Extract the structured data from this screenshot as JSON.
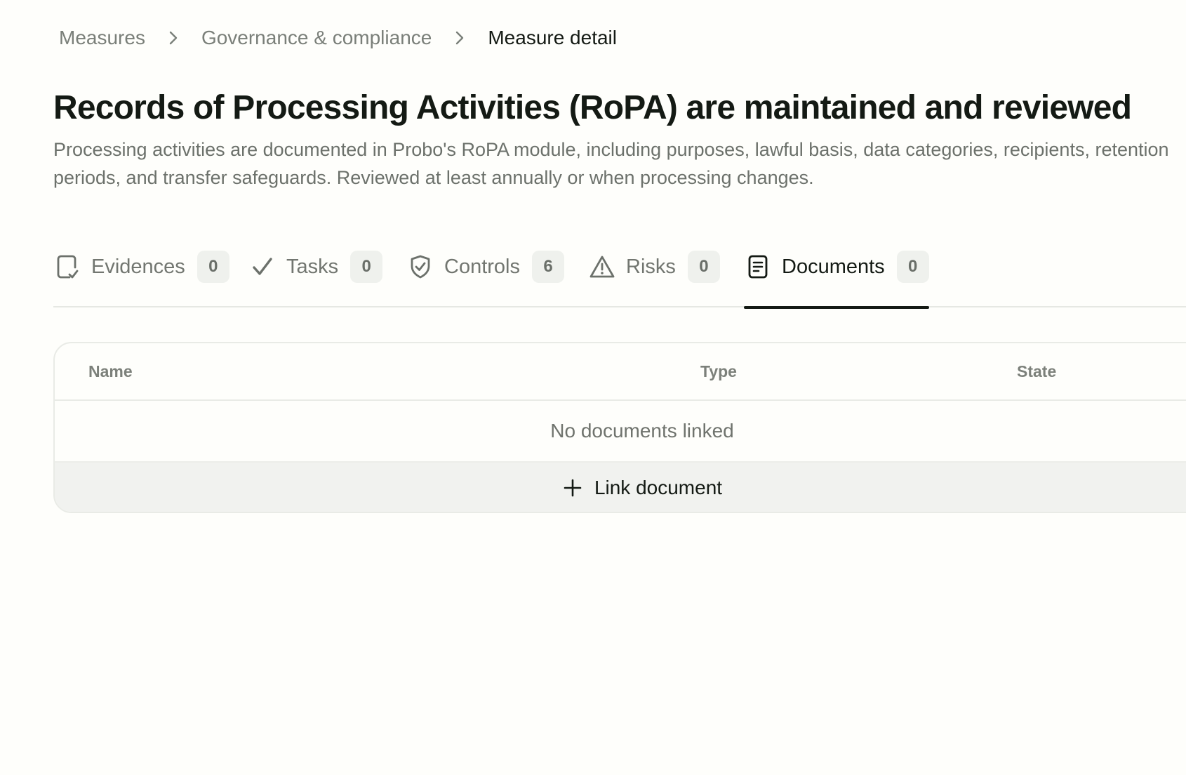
{
  "breadcrumb": {
    "items": [
      {
        "label": "Measures"
      },
      {
        "label": "Governance & compliance"
      },
      {
        "label": "Measure detail"
      }
    ]
  },
  "measure": {
    "title": "Records of Processing Activities (RoPA) are maintained and reviewed",
    "description_line1": "Processing activities are documented in Probo's RoPA module, including purposes, lawful basis, data categories, recipients, retention",
    "description_line2": "periods, and transfer safeguards. Reviewed at least annually or when processing changes."
  },
  "tabs": [
    {
      "label": "Evidences",
      "count": "0",
      "icon": "evidence-icon"
    },
    {
      "label": "Tasks",
      "count": "0",
      "icon": "check-icon"
    },
    {
      "label": "Controls",
      "count": "6",
      "icon": "shield-check-icon"
    },
    {
      "label": "Risks",
      "count": "0",
      "icon": "warning-icon"
    },
    {
      "label": "Documents",
      "count": "0",
      "icon": "document-icon",
      "active": true
    }
  ],
  "documents_table": {
    "columns": [
      "Name",
      "Type",
      "State"
    ],
    "empty_text": "No documents linked",
    "link_button_label": "Link document"
  },
  "colors": {
    "background": "#fefefb",
    "text_primary": "#141a14",
    "text_muted": "#7a7f79",
    "badge_bg": "#eff1ed",
    "active_underline": "#141a14"
  }
}
